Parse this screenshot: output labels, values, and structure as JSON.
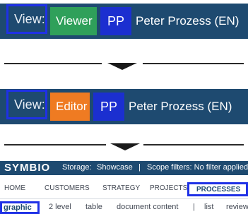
{
  "panel_viewer": {
    "view_label": "View:",
    "mode": "Viewer",
    "initials": "PP",
    "user_name": "Peter Prozess (EN)"
  },
  "panel_editor": {
    "view_label": "View:",
    "mode": "Editor",
    "initials": "PP",
    "user_name": "Peter Prozess (EN)"
  },
  "symbio": {
    "logo": "SYMBIO",
    "storage_label": "Storage:",
    "storage_value": "Showcase",
    "separator": "|",
    "scope_filters": "Scope filters: No filter applied",
    "nav": [
      "HOME",
      "CUSTOMERS",
      "STRATEGY",
      "PROJECTS",
      "PROCESSES"
    ],
    "subnav": [
      "graphic",
      "2 level",
      "table",
      "document content",
      "|",
      "list",
      "review"
    ]
  },
  "colors": {
    "header_bg": "#1e4a70",
    "viewer_green": "#2fa05a",
    "editor_orange": "#ef7b22",
    "initials_blue": "#1b2fd0",
    "highlight_border": "#1f31e6"
  },
  "icons": [
    "arrow-down-icon"
  ]
}
